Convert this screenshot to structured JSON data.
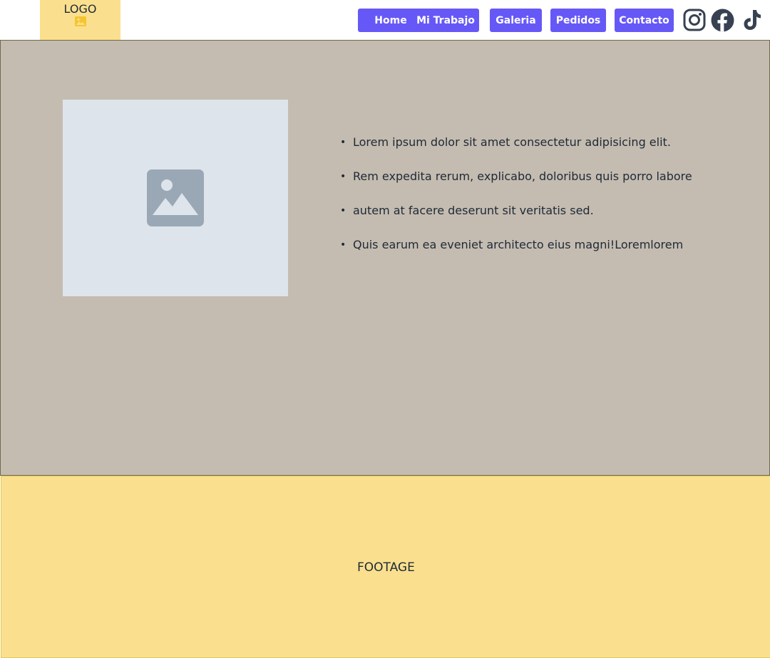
{
  "header": {
    "logo_label": "LOGO",
    "logo_icon": "image-icon",
    "nav": [
      {
        "label": "Home"
      },
      {
        "label": "Mi Trabajo"
      },
      {
        "label": "Galeria"
      },
      {
        "label": "Pedidos"
      },
      {
        "label": "Contacto"
      }
    ],
    "social_icons": [
      "instagram-icon",
      "facebook-icon",
      "tiktok-icon"
    ]
  },
  "main": {
    "image_placeholder_icon": "image-placeholder-icon",
    "bullets": [
      "Lorem ipsum dolor sit amet consectetur adipisicing elit.",
      "Rem expedita rerum, explicabo, doloribus quis porro labore",
      "autem at facere deserunt sit veritatis sed.",
      "Quis earum ea eveniet architecto eius magni!Loremlorem"
    ]
  },
  "footer": {
    "text": "FOOTAGE"
  },
  "colors": {
    "accent": "#6658f6",
    "logo_bg": "#fae08e",
    "main_bg": "#c4bcb0",
    "placeholder_bg": "#dee4ec",
    "icon_gray": "#9aa8b6",
    "text": "#1f2937"
  }
}
